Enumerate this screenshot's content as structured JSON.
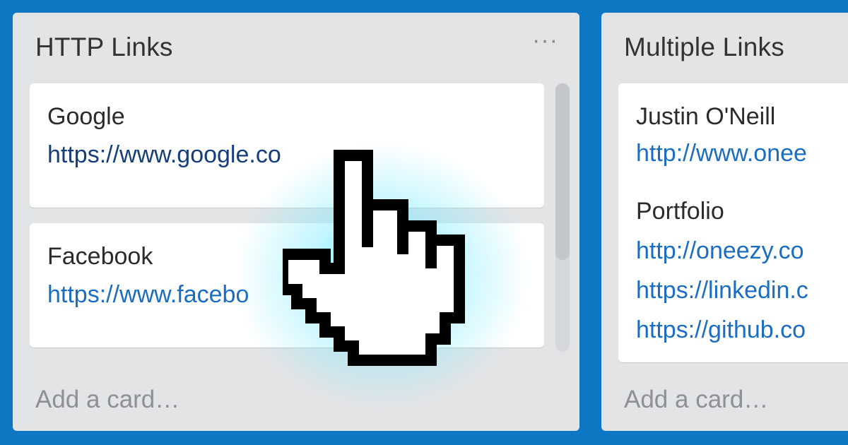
{
  "lists": [
    {
      "title": "HTTP Links",
      "menu": "···",
      "cards": [
        {
          "title": "Google",
          "link": "https://www.google.co"
        },
        {
          "title": "Facebook",
          "link": "https://www.facebo"
        }
      ],
      "add_card": "Add a card…"
    },
    {
      "title": "Multiple Links",
      "card": {
        "title": "Justin O'Neill",
        "link": "http://www.onee",
        "subtitle": "Portfolio",
        "links": [
          "http://oneezy.co",
          "https://linkedin.c",
          "https://github.co"
        ]
      },
      "add_card": "Add a card…"
    }
  ],
  "colors": {
    "board_bg": "#0d77c4",
    "list_bg": "#e2e4e6",
    "link": "#1b6dc1",
    "cursor_glow": "#50e6ff"
  },
  "icons": {
    "cursor": "pointing-hand-cursor-icon",
    "menu": "more-dots-icon"
  }
}
